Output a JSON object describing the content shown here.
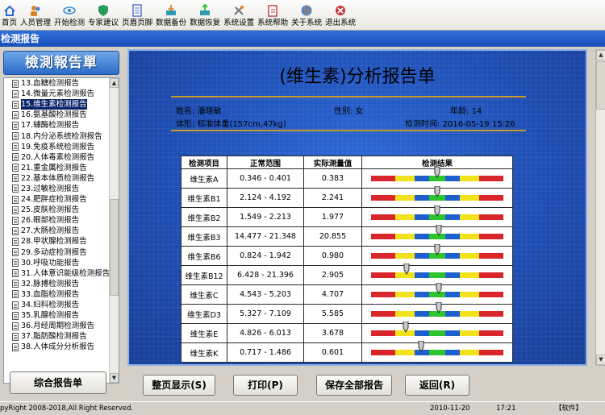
{
  "toolbar": {
    "items": [
      {
        "label": "首页",
        "icon": "home-icon",
        "color": "#2e6ad1"
      },
      {
        "label": "人员管理",
        "icon": "users-icon",
        "color": "#d9822b"
      },
      {
        "label": "开始检测",
        "icon": "eye-icon",
        "color": "#3a8fd9"
      },
      {
        "label": "专家建议",
        "icon": "shield-icon",
        "color": "#2a9a5a"
      },
      {
        "label": "页眉页脚",
        "icon": "document-icon",
        "color": "#4a70c9"
      },
      {
        "label": "数据备份",
        "icon": "backup-icon",
        "color": "#2e9bb2"
      },
      {
        "label": "数据恢复",
        "icon": "restore-icon",
        "color": "#2e9bb2"
      },
      {
        "label": "系统设置",
        "icon": "tools-icon",
        "color": "#7a7a7a"
      },
      {
        "label": "系统帮助",
        "icon": "help-icon",
        "color": "#c43838"
      },
      {
        "label": "关于系统",
        "icon": "globe-icon",
        "color": "#d96a2b"
      },
      {
        "label": "退出系统",
        "icon": "exit-icon",
        "color": "#c43838"
      }
    ]
  },
  "window": {
    "title": "检测报告"
  },
  "sidebar": {
    "logo_text": "檢測報告單",
    "items": [
      "13.血糖检测报告",
      "14.微量元素检测报告",
      "15.维生素检测报告",
      "16.氨基酸检测报告",
      "17.辅酶检测报告",
      "18.内分泌系统检测报告",
      "19.免疫系统检测报告",
      "20.人体毒素检测报告",
      "21.重金属检测报告",
      "22.基本体质检测报告",
      "23.过敏检测报告",
      "24.肥胖症检测报告",
      "25.皮肤检测报告",
      "26.眼部检测报告",
      "27.大肠检测报告",
      "28.甲状腺检测报告",
      "29.多动症检测报告",
      "30.呼吸功能报告",
      "31.人体意识能级检测报告",
      "32.脉搏检测报告",
      "33.血脂检测报告",
      "34.妇科检测报告",
      "35.乳腺检测报告",
      "36.月经周期检测报告",
      "37.脂肪酸检测报告",
      "38.人体成分分析报告"
    ],
    "selected_index": 2,
    "summary_button": "综合报告单"
  },
  "report": {
    "title": "(维生素)分析报告单",
    "name": "姓名: 潘晓敏",
    "gender": "性别: 女",
    "age": "年龄: 14",
    "body": "体形: 标准体重(157cm,47kg)",
    "test_time": "检测时间: 2016-05-19 15:26",
    "headers": [
      "检测项目",
      "正常范围",
      "实际测量值",
      "检测结果"
    ],
    "rows": [
      {
        "item": "维生素A",
        "range": "0.346 - 0.401",
        "value": "0.383",
        "level": 0.5
      },
      {
        "item": "维生素B1",
        "range": "2.124 - 4.192",
        "value": "2.241",
        "level": 0.5
      },
      {
        "item": "维生素B2",
        "range": "1.549 - 2.213",
        "value": "1.977",
        "level": 0.5
      },
      {
        "item": "维生素B3",
        "range": "14.477 - 21.348",
        "value": "20.855",
        "level": 0.51
      },
      {
        "item": "维生素B6",
        "range": "0.824 - 1.942",
        "value": "0.980",
        "level": 0.5
      },
      {
        "item": "维生素B12",
        "range": "6.428 - 21.396",
        "value": "2.905",
        "level": 0.27
      },
      {
        "item": "维生素C",
        "range": "4.543 - 5.203",
        "value": "4.707",
        "level": 0.51
      },
      {
        "item": "维生素D3",
        "range": "5.327 - 7.109",
        "value": "5.585",
        "level": 0.51
      },
      {
        "item": "维生素E",
        "range": "4.826 - 6.013",
        "value": "3.678",
        "level": 0.26
      },
      {
        "item": "维生素K",
        "range": "0.717 - 1.486",
        "value": "0.601",
        "level": 0.38
      }
    ],
    "gauge_colors": [
      "#d9262b",
      "#f2e21c",
      "#1e5fd0",
      "#2ec42e",
      "#1e5fd0",
      "#f2e21c",
      "#d9262b"
    ]
  },
  "actions": {
    "full_page": "整页显示(S)",
    "print": "打印(P)",
    "save_all": "保存全部报告",
    "back": "返回(R)"
  },
  "status": {
    "copyright": "pyRight 2008-2018,All Right Reserved.",
    "date": "2010-11-20",
    "time": "17:21",
    "software": "【软件】"
  }
}
